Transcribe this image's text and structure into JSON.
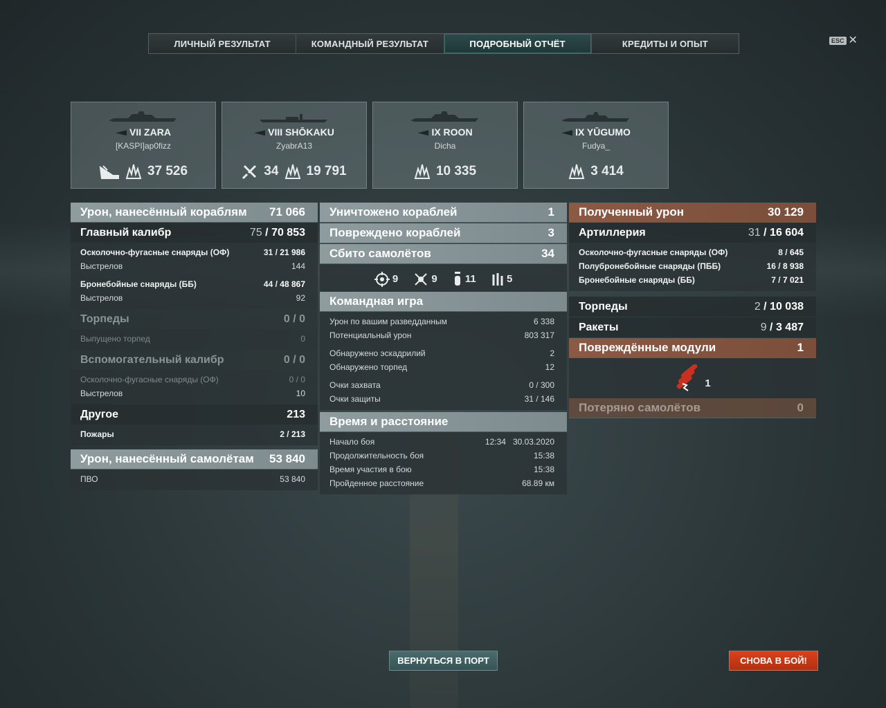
{
  "tabs": [
    "ЛИЧНЫЙ РЕЗУЛЬТАТ",
    "КОМАНДНЫЙ РЕЗУЛЬТАТ",
    "ПОДРОБНЫЙ ОТЧЁТ",
    "КРЕДИТЫ И ОПЫТ"
  ],
  "active_tab": "ПОДРОБНЫЙ ОТЧЁТ",
  "esc": {
    "key": "ESC",
    "close": "✕"
  },
  "ships": [
    {
      "name": "VII ZARA",
      "player": "[KASPI]ap0fizz",
      "planes": "",
      "damage": "37 526",
      "icons": [
        "sunk-ship-icon",
        "explosion-icon"
      ]
    },
    {
      "name": "VIII SHŌKAKU",
      "player": "ZyabrA13",
      "planes": "34",
      "damage": "19 791",
      "icons": [
        "plane-shot-icon",
        "explosion-icon"
      ]
    },
    {
      "name": "IX ROON",
      "player": "Dicha",
      "planes": "",
      "damage": "10 335",
      "icons": [
        "explosion-icon"
      ]
    },
    {
      "name": "IX YŪGUMO",
      "player": "Fudya_",
      "planes": "",
      "damage": "3 414",
      "icons": [
        "explosion-icon"
      ]
    }
  ],
  "left": {
    "ship_damage": {
      "label": "Урон, нанесённый кораблям",
      "value": "71 066"
    },
    "main": {
      "label": "Главный калибр",
      "hits": "75",
      "dmg": "70 853"
    },
    "he": {
      "label": "Осколочно-фугасные снаряды (ОФ)",
      "hits": "31",
      "dmg": "21 986"
    },
    "he_shots": {
      "label": "Выстрелов",
      "value": "144"
    },
    "ap": {
      "label": "Бронебойные снаряды (ББ)",
      "hits": "44",
      "dmg": "48 867"
    },
    "ap_shots": {
      "label": "Выстрелов",
      "value": "92"
    },
    "torps": {
      "label": "Торпеды",
      "hits": "0",
      "dmg": "0"
    },
    "torps_fired": {
      "label": "Выпущено торпед",
      "value": "0"
    },
    "secondary": {
      "label": "Вспомогательный калибр",
      "hits": "0",
      "dmg": "0"
    },
    "sec_he": {
      "label": "Осколочно-фугасные снаряды (ОФ)",
      "hits": "0",
      "dmg": "0"
    },
    "sec_shots": {
      "label": "Выстрелов",
      "value": "10"
    },
    "other": {
      "label": "Другое",
      "value": "213"
    },
    "fires": {
      "label": "Пожары",
      "hits": "2",
      "dmg": "213"
    },
    "plane_damage": {
      "label": "Урон, нанесённый самолётам",
      "value": "53 840"
    },
    "aa": {
      "label": "ПВО",
      "value": "53 840"
    }
  },
  "center": {
    "destroyed": {
      "label": "Уничтожено кораблей",
      "value": "1"
    },
    "damaged": {
      "label": "Повреждено кораблей",
      "value": "3"
    },
    "planes": {
      "label": "Сбито самолётов",
      "value": "34"
    },
    "plane_types": [
      {
        "icon": "crosshair-icon",
        "count": "9"
      },
      {
        "icon": "bomber-icon",
        "count": "9"
      },
      {
        "icon": "bomb-icon",
        "count": "11"
      },
      {
        "icon": "rockets-icon",
        "count": "5"
      }
    ],
    "team_title": "Командная игра",
    "spot_dmg": {
      "label": "Урон по вашим разведданным",
      "value": "6 338"
    },
    "potential": {
      "label": "Потенциальный урон",
      "value": "803 317"
    },
    "squadrons": {
      "label": "Обнаружено эскадрилий",
      "value": "2"
    },
    "torps_spotted": {
      "label": "Обнаружено торпед",
      "value": "12"
    },
    "capture": {
      "label": "Очки захвата",
      "value": "0 / 300"
    },
    "defense": {
      "label": "Очки защиты",
      "value": "31 / 146"
    },
    "time_title": "Время и расстояние",
    "start": {
      "label": "Начало боя",
      "time": "12:34",
      "date": "30.03.2020"
    },
    "duration": {
      "label": "Продолжительность боя",
      "value": "15:38"
    },
    "participation": {
      "label": "Время участия в бою",
      "value": "15:38"
    },
    "distance": {
      "label": "Пройденное расстояние",
      "value": "68.89 км"
    }
  },
  "right": {
    "received": {
      "label": "Полученный урон",
      "value": "30 129"
    },
    "artillery": {
      "label": "Артиллерия",
      "hits": "31",
      "dmg": "16 604"
    },
    "he": {
      "label": "Осколочно-фугасные снаряды (ОФ)",
      "hits": "8",
      "dmg": "645"
    },
    "sap": {
      "label": "Полубронебойные снаряды (ПББ)",
      "hits": "16",
      "dmg": "8 938"
    },
    "ap": {
      "label": "Бронебойные снаряды (ББ)",
      "hits": "7",
      "dmg": "7 021"
    },
    "torps": {
      "label": "Торпеды",
      "hits": "2",
      "dmg": "10 038"
    },
    "rockets": {
      "label": "Ракеты",
      "hits": "9",
      "dmg": "3 487"
    },
    "modules": {
      "label": "Повреждённые модули",
      "value": "1"
    },
    "module_icon_count": "1",
    "lost_planes": {
      "label": "Потеряно самолётов",
      "value": "0"
    }
  },
  "buttons": {
    "port": "ВЕРНУТЬСЯ В ПОРТ",
    "battle": "СНОВА В БОЙ!"
  },
  "colors": {
    "active_tab": "#1f3838",
    "rust": "#8b5a45",
    "battle_button": "#d9421c",
    "port_button": "#4a6c6e"
  }
}
